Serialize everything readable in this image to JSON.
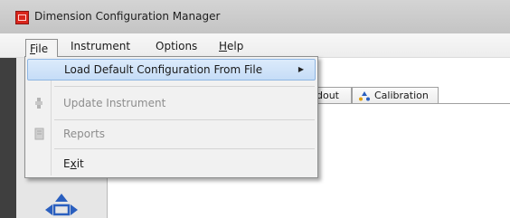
{
  "window": {
    "title": "Dimension Configuration Manager"
  },
  "menubar": {
    "items": [
      {
        "label": "File",
        "mnemonic": "F",
        "rest": "ile"
      },
      {
        "label": "Instrument"
      },
      {
        "label": "Options"
      },
      {
        "label": "Help",
        "mnemonic": "H",
        "rest": "elp"
      }
    ]
  },
  "tabs": [
    {
      "label": "dout"
    },
    {
      "label": "Calibration",
      "icon": "calibration-icon"
    }
  ],
  "file_menu": {
    "items": [
      {
        "label": "Load Default Configuration From File",
        "state": "highlighted",
        "has_submenu": true,
        "arrow": "▶"
      },
      {
        "label": "Update Instrument",
        "state": "disabled",
        "icon": "update-instrument-icon"
      },
      {
        "label": "Reports",
        "state": "disabled",
        "icon": "reports-icon"
      },
      {
        "label": "Exit",
        "mnemonic": "x",
        "prefix": "E",
        "rest": "it"
      }
    ]
  },
  "colors": {
    "titlebar": "#c8c8c8",
    "highlight": "#cfe3f9",
    "highlight_border": "#8fb6e2",
    "app_icon": "#d9261c",
    "left_strip": "#3f3f3f"
  }
}
